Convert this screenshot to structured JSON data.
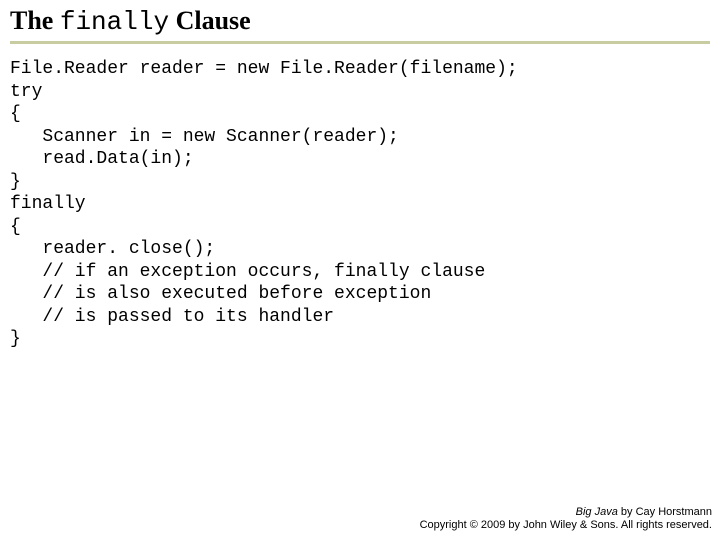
{
  "title": {
    "prefix": "The ",
    "keyword": "finally",
    "suffix": " Clause"
  },
  "code": "File.Reader reader = new File.Reader(filename);\ntry\n{\n   Scanner in = new Scanner(reader);\n   read.Data(in);\n}\nfinally\n{\n   reader. close();\n   // if an exception occurs, finally clause\n   // is also executed before exception\n   // is passed to its handler\n}",
  "footer": {
    "line1_book": "Big Java",
    "line1_rest": " by Cay Horstmann",
    "line2": "Copyright © 2009 by John Wiley & Sons. All rights reserved."
  }
}
